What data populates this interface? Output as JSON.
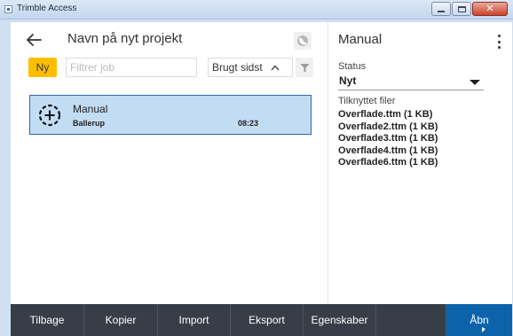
{
  "window": {
    "title": "Trimble Access"
  },
  "header": {
    "title": "Navn på nyt projekt"
  },
  "controls": {
    "new_label": "Ny",
    "filter_placeholder": "Filtrer job",
    "sort_label": "Brugt sidst"
  },
  "jobs": [
    {
      "name": "Manual",
      "location": "Ballerup",
      "time": "08:23"
    }
  ],
  "details": {
    "title": "Manual",
    "status_label": "Status",
    "status_value": "Nyt",
    "files_label": "Tilknyttet filer",
    "files": [
      "Overflade.ttm (1 KB)",
      "Overflade2.ttm (1 KB)",
      "Overflade3.ttm (1 KB)",
      "Overflade4.ttm (1 KB)",
      "Overflade6.ttm (1 KB)"
    ]
  },
  "toolbar": {
    "back": "Tilbage",
    "copy": "Kopier",
    "import": "Import",
    "export": "Eksport",
    "properties": "Egenskaber",
    "open": "Åbn"
  },
  "colors": {
    "accent_yellow": "#ffbe00",
    "selected_row": "#c2dcf3",
    "toolbar_bg": "#373e48",
    "primary_blue": "#0c63ab"
  }
}
